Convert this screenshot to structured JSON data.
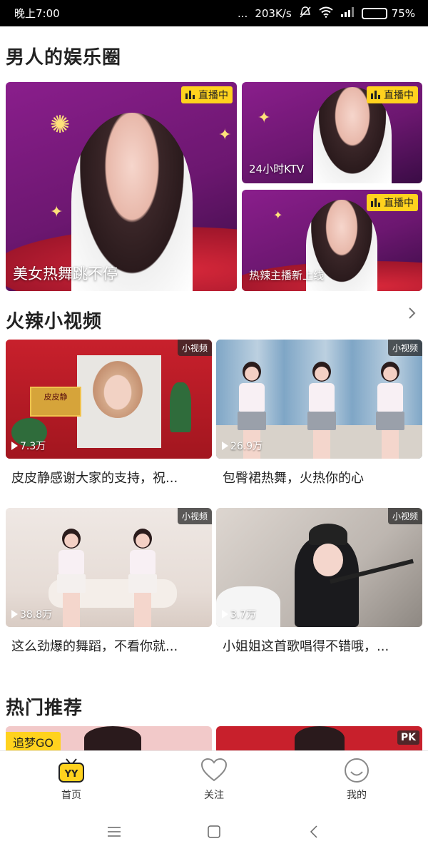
{
  "status_bar": {
    "time": "晚上7:00",
    "dots": "...",
    "network_speed": "203K/s",
    "battery": "75%",
    "battery_level": 0.75,
    "icons": [
      "muted-icon",
      "wifi-icon",
      "signal-icon",
      "battery-icon"
    ]
  },
  "section_entertainment": {
    "title": "男人的娱乐圈",
    "cards": [
      {
        "caption": "美女热舞跳不停",
        "badge": "直播中"
      },
      {
        "caption": "24小时KTV",
        "badge": "直播中"
      },
      {
        "caption": "热辣主播新上线",
        "badge": "直播中"
      }
    ]
  },
  "section_videos": {
    "title": "火辣小视频",
    "more_icon": "chevron-right-icon",
    "items": [
      {
        "tag": "小视频",
        "plays": "7.3万",
        "title": "皮皮静感谢大家的支持，祝...",
        "sign_text": "皮皮静"
      },
      {
        "tag": "小视频",
        "plays": "26.9万",
        "title": "包臀裙热舞，火热你的心"
      },
      {
        "tag": "小视频",
        "plays": "38.8万",
        "title": "这么劲爆的舞蹈，不看你就..."
      },
      {
        "tag": "小视频",
        "plays": "3.7万",
        "title": "小姐姐这首歌唱得不错哦，..."
      }
    ]
  },
  "section_hot": {
    "title": "热门推荐",
    "cards": [
      {
        "badge": "追梦GO"
      },
      {
        "badge": "PK"
      }
    ]
  },
  "bottom_nav": {
    "items": [
      {
        "label": "首页",
        "icon": "yy-home-icon"
      },
      {
        "label": "关注",
        "icon": "heart-icon"
      },
      {
        "label": "我的",
        "icon": "smile-icon"
      }
    ]
  },
  "colors": {
    "accent_yellow": "#ffd21e",
    "live_purple": "#7a1a7e",
    "festive_red": "#c8202c"
  }
}
